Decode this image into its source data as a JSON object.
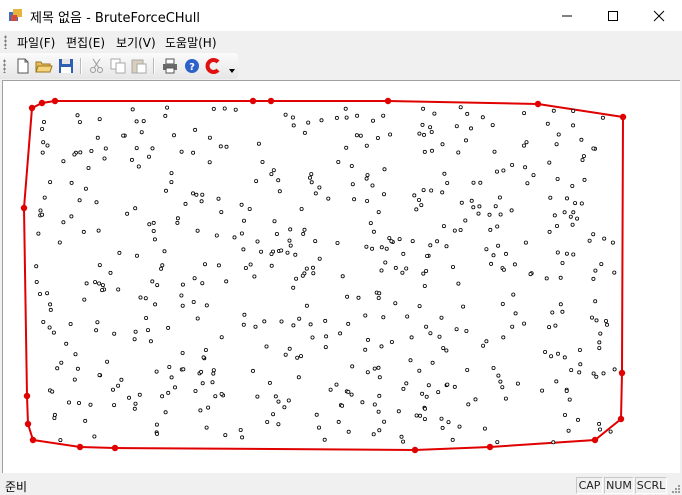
{
  "window": {
    "title": "제목 없음 - BruteForceCHull",
    "controls": [
      "minimize",
      "maximize",
      "close"
    ]
  },
  "menu": {
    "items": [
      {
        "label": "파일(F)"
      },
      {
        "label": "편집(E)"
      },
      {
        "label": "보기(V)"
      },
      {
        "label": "도움말(H)"
      }
    ]
  },
  "toolbar": {
    "buttons": [
      "new-icon",
      "open-icon",
      "save-icon",
      "cut-icon",
      "copy-icon",
      "paste-icon",
      "print-icon",
      "help-icon",
      "app-about-icon"
    ]
  },
  "canvas": {
    "hull_color": "#e00000",
    "point_color": "#000000"
  },
  "status": {
    "text": "준비",
    "indicators": [
      "CAP",
      "NUM",
      "SCRL"
    ]
  }
}
